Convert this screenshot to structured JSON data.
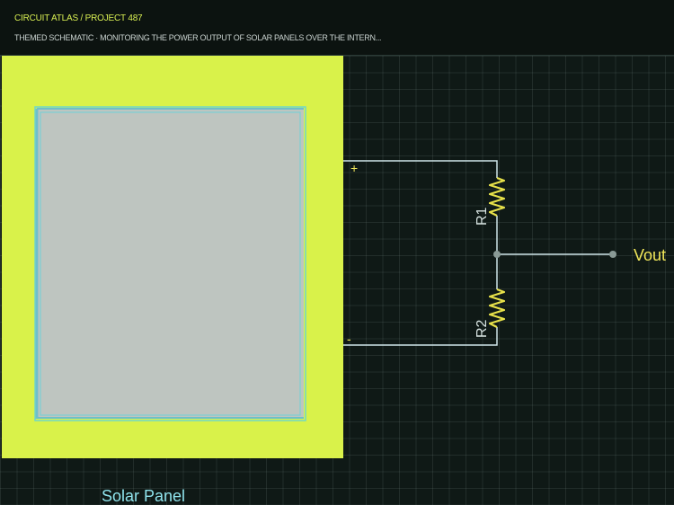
{
  "header": {
    "title": "CIRCUIT ATLAS / PROJECT 487",
    "subtitle": "THEMED SCHEMATIC · MONITORING THE POWER OUTPUT OF SOLAR PANELS OVER THE INTERN..."
  },
  "schematic": {
    "panel_label": "Solar Panel",
    "terminal_plus": "+",
    "terminal_minus": "-",
    "resistor_top_label": "R1",
    "resistor_bottom_label": "R2",
    "output_label": "Vout"
  },
  "colors": {
    "background": "#0f1916",
    "grid": "#2f3f3b",
    "panel_frame": "#d9f24a",
    "panel_cell": "#bec5c0",
    "panel_edge": "#5ed3de",
    "wire": "#cfe6e8",
    "resistor": "#e8e24a",
    "node": "#8a9a96",
    "label_accent": "#f2e85a",
    "label_light": "#d8e4e2",
    "label_cyan": "#8fe3ec"
  }
}
